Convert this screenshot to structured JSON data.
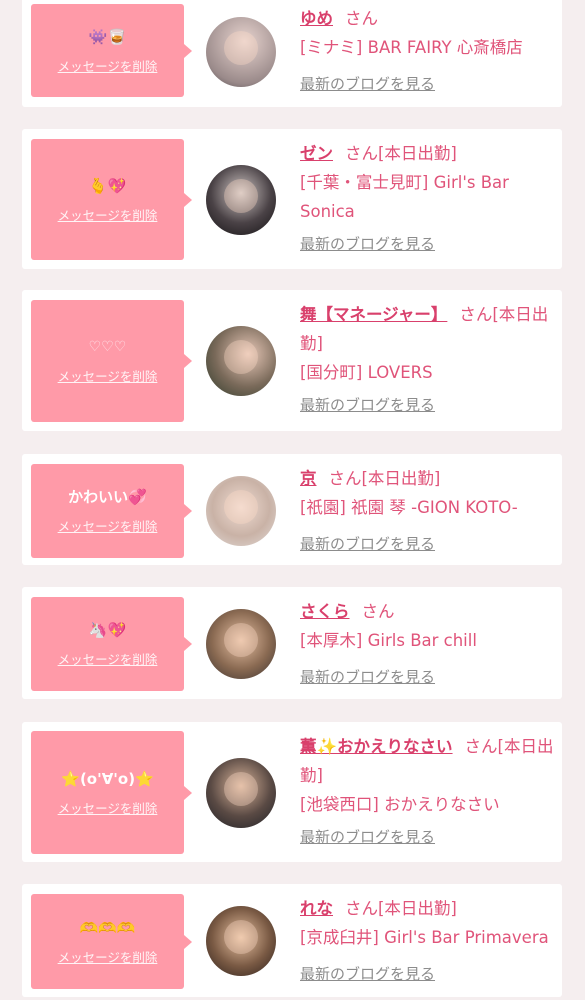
{
  "colors": {
    "accent": "#e0547a",
    "bubble": "#ff9aa8",
    "background": "#f5eeef"
  },
  "cards": [
    {
      "message": "👾🥃",
      "delete_label": "メッセージを削除",
      "name": "ゆめ",
      "suffix": "さん",
      "shop": "[ミナミ] BAR FAIRY 心斎橋店",
      "blog_link": "最新のブログを見る"
    },
    {
      "message": "🫰💖",
      "delete_label": "メッセージを削除",
      "name": "ゼン",
      "suffix": "さん[本日出勤]",
      "shop": "[千葉・富士見町] Girl's Bar Sonica",
      "blog_link": "最新のブログを見る"
    },
    {
      "message": "♡♡♡",
      "delete_label": "メッセージを削除",
      "name": "舞【マネージャー】",
      "suffix": "さん[本日出勤]",
      "shop": "[国分町] LOVERS",
      "blog_link": "最新のブログを見る"
    },
    {
      "message": "かわいい💞",
      "delete_label": "メッセージを削除",
      "name": "京",
      "suffix": "さん[本日出勤]",
      "shop": "[祇園] 祇園 琴 -GION KOTO-",
      "blog_link": "最新のブログを見る"
    },
    {
      "message": "🦄💖",
      "delete_label": "メッセージを削除",
      "name": "さくら",
      "suffix": "さん",
      "shop": "[本厚木] Girls Bar chill",
      "blog_link": "最新のブログを見る"
    },
    {
      "message": "⭐(o'∀'o)⭐",
      "delete_label": "メッセージを削除",
      "name": "薫✨おかえりなさい",
      "suffix": "さん[本日出勤]",
      "shop": "[池袋西口] おかえりなさい",
      "blog_link": "最新のブログを見る"
    },
    {
      "message": "🫶🫶🫶",
      "delete_label": "メッセージを削除",
      "name": "れな",
      "suffix": "さん[本日出勤]",
      "shop": "[京成臼井] Girl's Bar Primavera",
      "blog_link": "最新のブログを見る"
    }
  ]
}
